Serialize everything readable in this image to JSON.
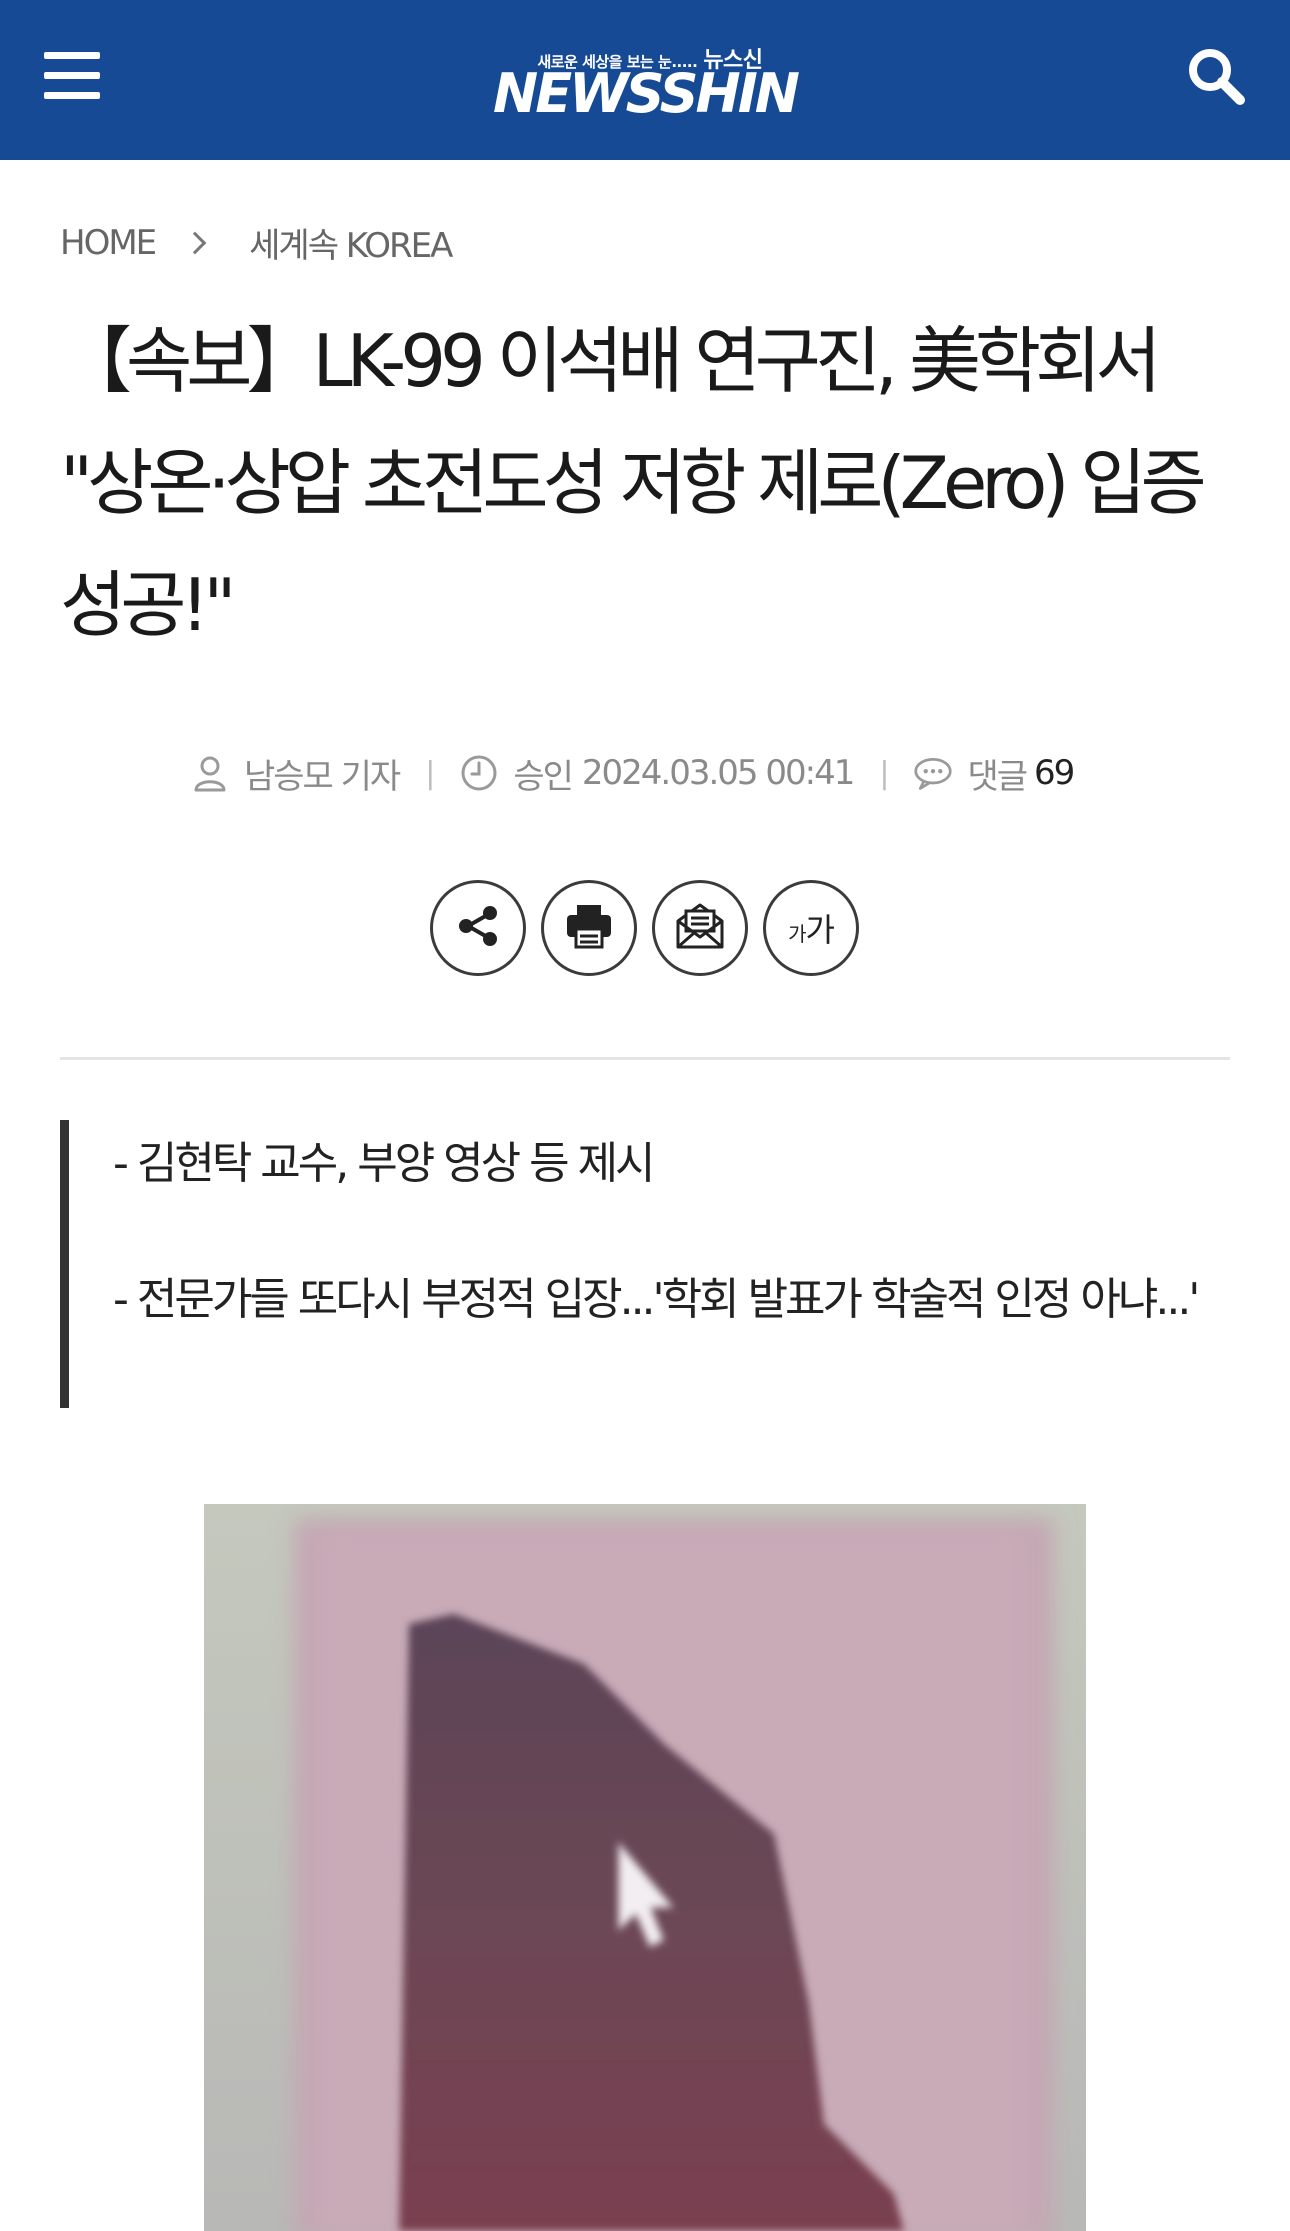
{
  "header": {
    "logo_tagline": "새로운 세상을 보는 눈.....",
    "logo_brand_ko": "뉴스신",
    "logo_text": "NEWSSHIN",
    "menu_icon": "hamburger-menu-icon",
    "search_icon": "search-icon",
    "background_color": "#174a95"
  },
  "breadcrumb": {
    "home": "HOME",
    "section": "세계속 KOREA"
  },
  "article": {
    "title": "【속보】LK-99 이석배 연구진, 美학회서 \"상온·상압 초전도성 저항 제로(Zero) 입증 성공!\"",
    "reporter": "남승모 기자",
    "approved_label": "승인",
    "approved_datetime": "2024.03.05 00:41",
    "comments_label": "댓글",
    "comments_count": "69",
    "summary": [
      "- 김현탁 교수, 부양 영상 등 제시",
      "- 전문가들 또다시 부정적 입장...'학회 발표가 학술적 인정 아냐...'"
    ]
  },
  "tools": {
    "share_icon": "share-icon",
    "print_icon": "print-icon",
    "email_icon": "email-icon",
    "font_size_small": "가",
    "font_size_big": "가"
  }
}
